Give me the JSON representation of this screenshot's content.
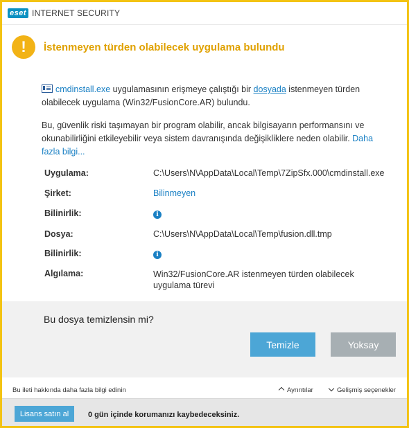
{
  "app": {
    "logo_text": "eset",
    "product_name": "INTERNET SECURITY"
  },
  "header": {
    "title": "İstenmeyen türden olabilecek uygulama bulundu",
    "icon": "warning-icon",
    "accent_color": "#e0a100"
  },
  "description": {
    "file_link": "cmdinstall.exe",
    "part1": " uygulamasının erişmeye çalıştığı bir ",
    "file_word_link": "dosyada",
    "part2": " istenmeyen türden olabilecek uygulama (Win32/FusionCore.AR) bulundu.",
    "para2": "Bu, güvenlik riski taşımayan bir program olabilir, ancak bilgisayarın performansını ve okunabilirliğini etkileyebilir veya sistem davranışında değişikliklere neden olabilir. ",
    "more_info_link": "Daha fazla bilgi..."
  },
  "details": {
    "app_label": "Uygulama:",
    "app_value": "C:\\Users\\N\\AppData\\Local\\Temp\\7ZipSfx.000\\cmdinstall.exe",
    "company_label": "Şirket:",
    "company_value": "Bilinmeyen",
    "reputation_label": "Bilinirlik:",
    "file_label": "Dosya:",
    "file_value": "C:\\Users\\N\\AppData\\Local\\Temp\\fusion.dll.tmp",
    "reputation2_label": "Bilinirlik:",
    "detection_label": "Algılama:",
    "detection_value": "Win32/FusionCore.AR istenmeyen türden olabilecek uygulama türevi"
  },
  "question": {
    "text": "Bu dosya temizlensin mi?",
    "clean_label": "Temizle",
    "ignore_label": "Yoksay"
  },
  "footer": {
    "more_info": "Bu ileti hakkında daha fazla bilgi edinin",
    "details_toggle": "Ayrıntılar",
    "advanced_toggle": "Gelişmiş seçenekler"
  },
  "license": {
    "buy_label": "Lisans satın al",
    "message": "0 gün içinde korumanızı kaybedeceksiniz."
  },
  "colors": {
    "border": "#f3c313",
    "primary_button": "#4ca6d6",
    "secondary_button": "#a7afb3",
    "link": "#1a80c4"
  }
}
